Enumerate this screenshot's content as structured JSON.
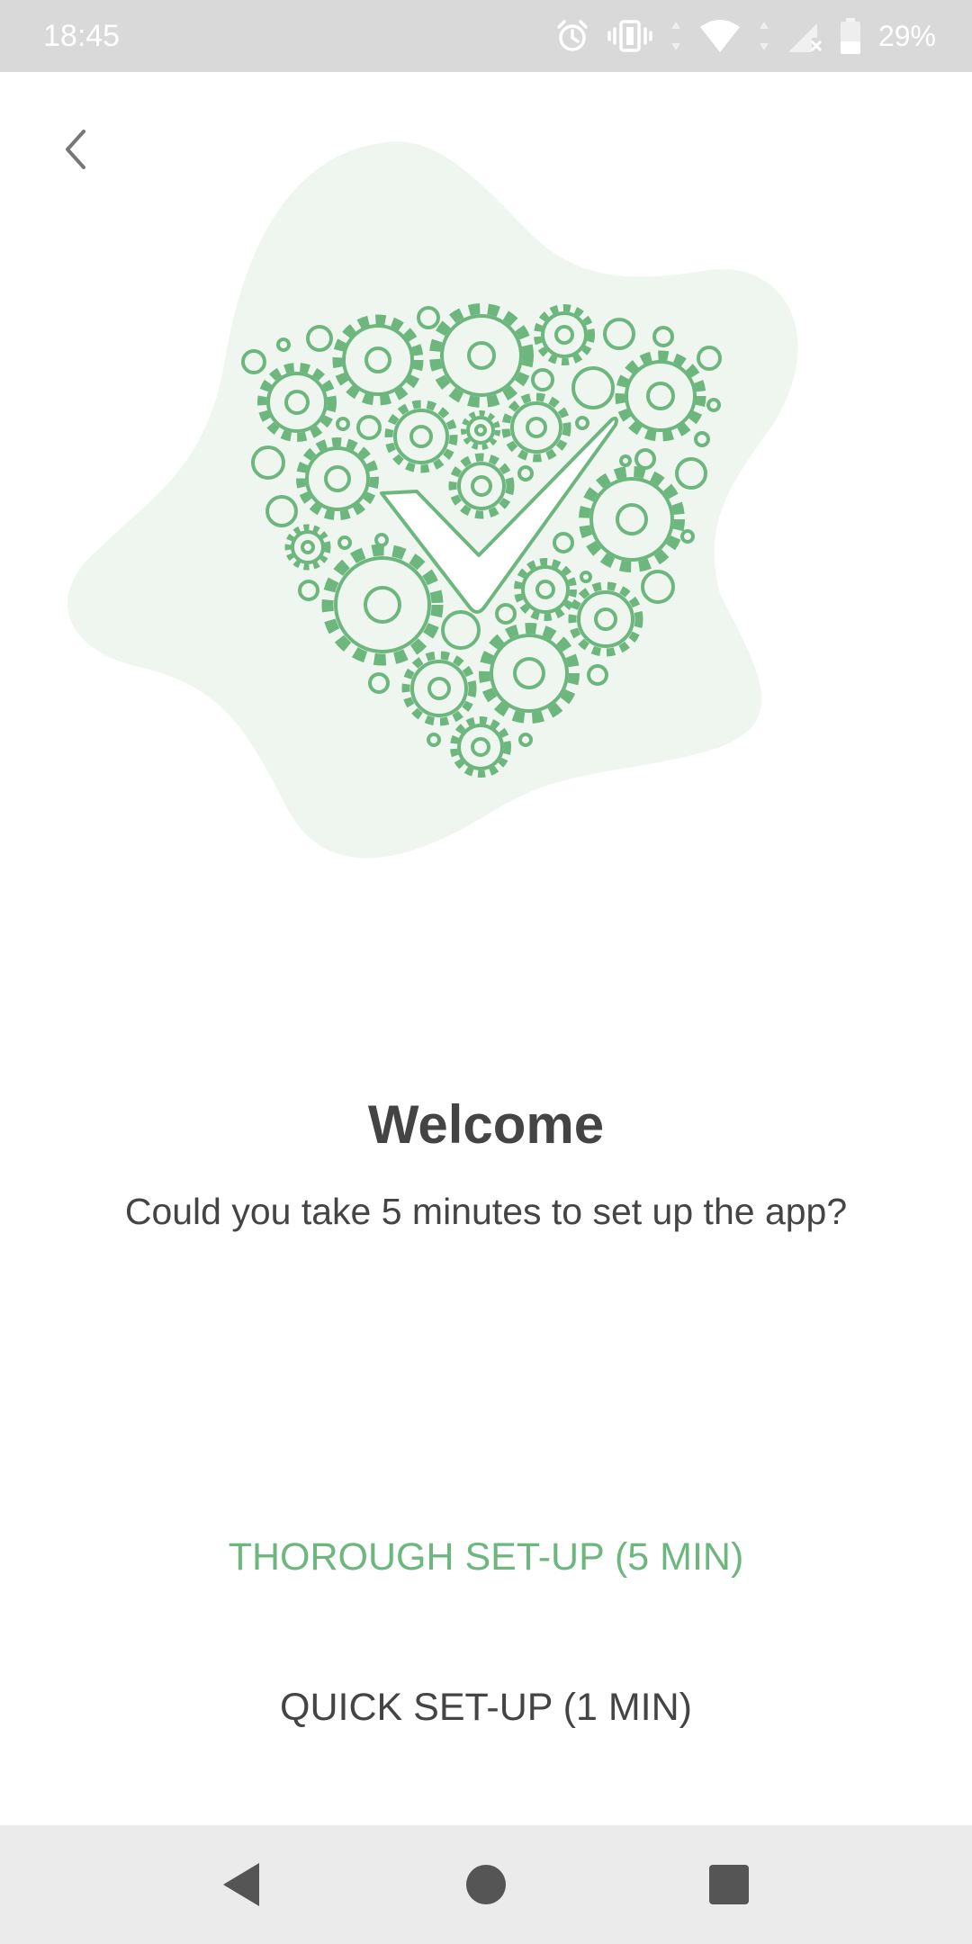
{
  "status_bar": {
    "time": "18:45",
    "battery_percent": "29%",
    "icons": [
      "alarm-icon",
      "vibrate-icon",
      "wifi-icon",
      "cell-signal-icon",
      "battery-icon"
    ]
  },
  "header": {
    "back_icon": "chevron-left-icon"
  },
  "illustration": {
    "icon": "gears-heart-checkmark-illustration",
    "accent_color": "#6db77e",
    "blob_color": "#eef6ef"
  },
  "main": {
    "title": "Welcome",
    "subtitle": "Could you take 5 minutes to set up the app?",
    "thorough_button_label": "THOROUGH SET-UP (5 MIN)",
    "quick_button_label": "QUICK SET-UP (1 MIN)"
  },
  "colors": {
    "accent": "#6db77e",
    "text": "#444444",
    "status_bar_bg": "#d9d9d9",
    "nav_bar_bg": "#ebebeb"
  },
  "nav_bar": {
    "icons": [
      "nav-back-icon",
      "nav-home-icon",
      "nav-recents-icon"
    ]
  }
}
